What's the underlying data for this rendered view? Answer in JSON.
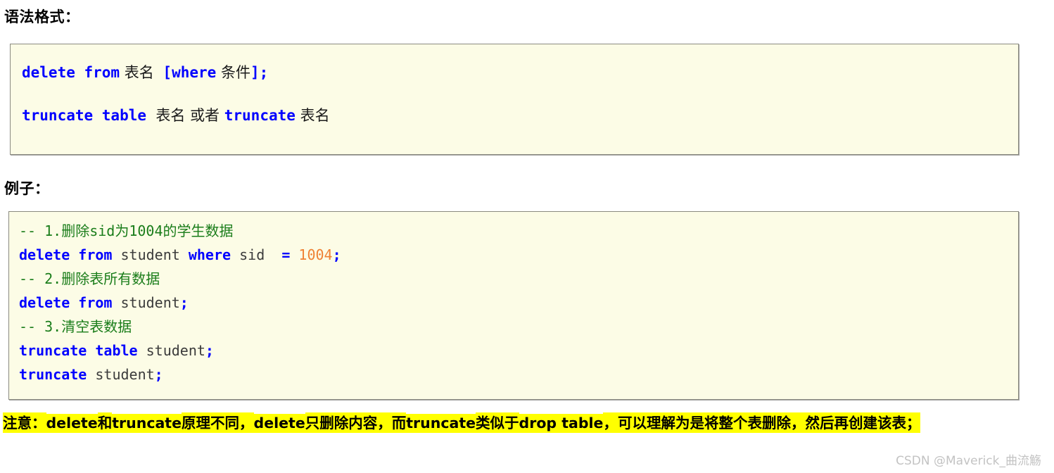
{
  "headings": {
    "syntax": "语法格式：",
    "example": "例子："
  },
  "syntax_block": {
    "line1": {
      "kw_delete_from": "delete from",
      "cjk_table_name": "表名",
      "bracket_where": "[where",
      "cjk_condition": "条件",
      "bracket_close": "];"
    },
    "line2": {
      "kw_truncate_table": "truncate table",
      "cjk_table_name": "表名",
      "cjk_or": "或者",
      "kw_truncate": "truncate",
      "cjk_table_name2": "表名"
    }
  },
  "example_block": {
    "comment1": "-- 1.删除sid为1004的学生数据",
    "stmt1": {
      "kw1": "delete from",
      "ident1": "student",
      "kw2": "where",
      "ident2": "sid",
      "op": "=",
      "num": "1004",
      "semi": ";"
    },
    "comment2": "-- 2.删除表所有数据",
    "stmt2": {
      "kw1": "delete from",
      "ident1": "student",
      "semi": ";"
    },
    "comment3": "-- 3.清空表数据",
    "stmt3": {
      "kw1": "truncate table",
      "ident1": "student",
      "semi": ";"
    },
    "stmt4": {
      "kw1": "truncate",
      "ident1": "student",
      "semi": ";"
    }
  },
  "note": {
    "seg1": "注意：",
    "seg2": "delete",
    "seg3": "和",
    "seg4": "truncate",
    "seg5": "原理不同，",
    "seg6": "delete",
    "seg7": "只删除内容，而",
    "seg8": "truncate",
    "seg9": "类似于",
    "seg10": "drop table",
    "seg11": "，可以理解为是将整个表删除，然后再创建该表；"
  },
  "watermark": "CSDN @Maverick_曲流觞",
  "colors": {
    "keyword": "#0000ff",
    "comment": "#1a7d1a",
    "number": "#ef8134",
    "identifier": "#3b3b3b",
    "code_bg": "#fcfce6",
    "code_border": "#8a8a80",
    "highlight": "#ffff00",
    "watermark": "#c3c3c3"
  }
}
